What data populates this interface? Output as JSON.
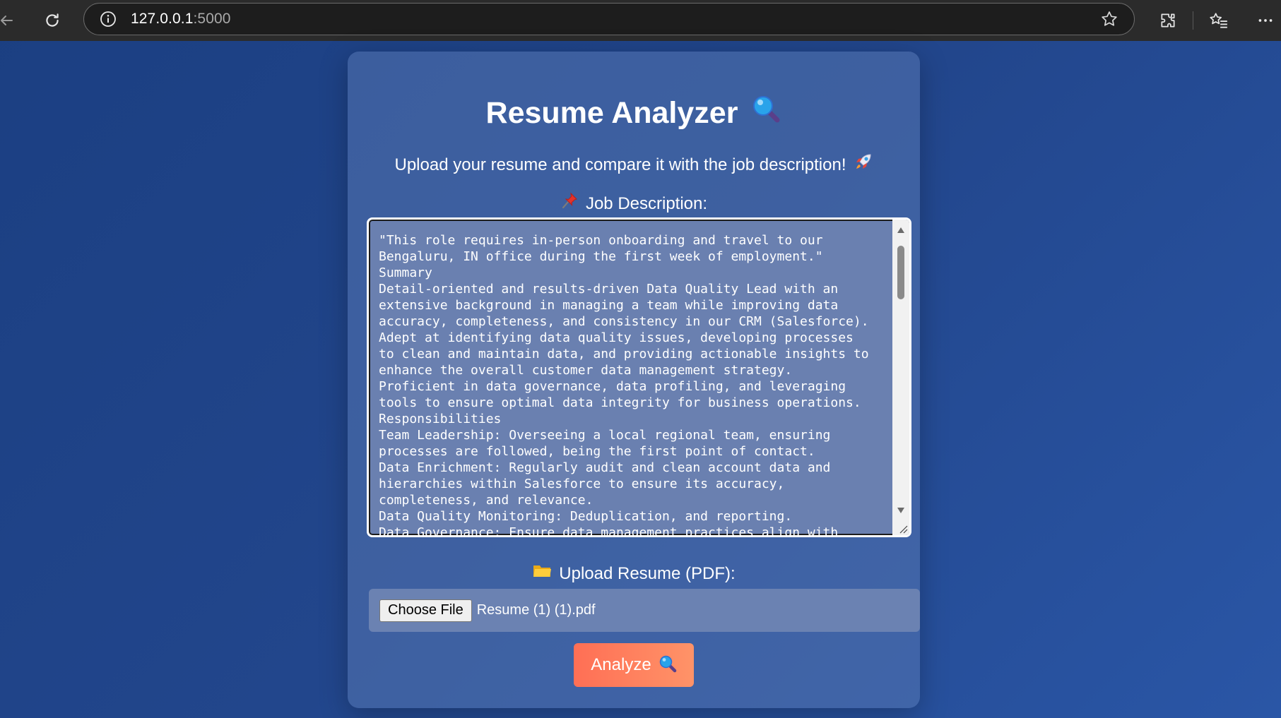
{
  "browser": {
    "url_host": "127.0.0.1",
    "url_port": ":5000"
  },
  "page": {
    "title": "Resume Analyzer",
    "subtitle": "Upload your resume and compare it with the job description!",
    "job_description_label": "Job Description:",
    "job_description_text": "\"This role requires in-person onboarding and travel to our\nBengaluru, IN office during the first week of employment.\"\nSummary\nDetail-oriented and results-driven Data Quality Lead with an\nextensive background in managing a team while improving data\naccuracy, completeness, and consistency in our CRM (Salesforce).\nAdept at identifying data quality issues, developing processes\nto clean and maintain data, and providing actionable insights to\nenhance the overall customer data management strategy.\nProficient in data governance, data profiling, and leveraging\ntools to ensure optimal data integrity for business operations.\nResponsibilities\nTeam Leadership: Overseeing a local regional team, ensuring\nprocesses are followed, being the first point of contact.\nData Enrichment: Regularly audit and clean account data and\nhierarchies within Salesforce to ensure its accuracy,\ncompleteness, and relevance.\nData Quality Monitoring: Deduplication, and reporting.\nData Governance: Ensure data management practices align with",
    "upload_label": "Upload Resume (PDF):",
    "choose_file_label": "Choose File",
    "file_name": "Resume (1) (1).pdf",
    "analyze_label": "Analyze"
  },
  "icons": {
    "title_icon": "magnifier-icon",
    "subtitle_icon": "rocket-icon",
    "jd_icon": "pushpin-icon",
    "upload_icon": "folder-icon",
    "analyze_icon": "magnifier-icon"
  },
  "colors": {
    "accent_button": "#ff7a5c",
    "background": "#22468c"
  }
}
